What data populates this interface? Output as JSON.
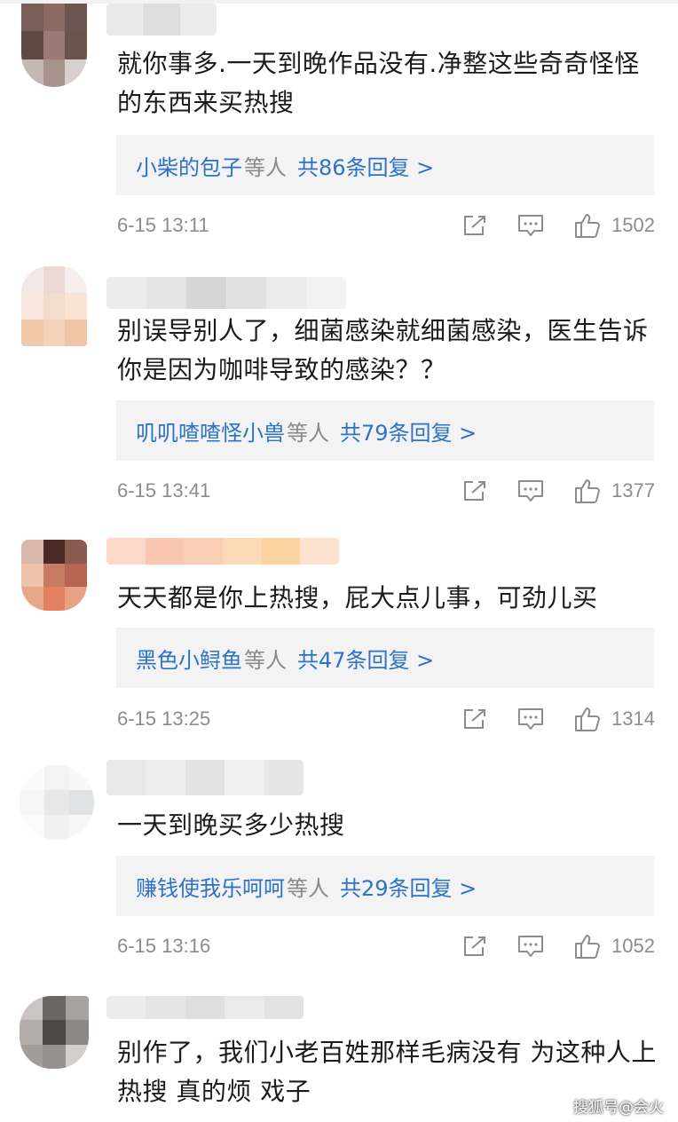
{
  "comments": [
    {
      "text": "就你事多.一天到晚作品没有.净整这些奇奇怪怪的东西来买热搜",
      "reply_names": "小柴的包子",
      "reply_others": "等人",
      "reply_count": "共86条回复 >",
      "time": "6-15 13:11",
      "likes": "1502"
    },
    {
      "text": "别误导别人了，细菌感染就细菌感染，医生告诉你是因为咖啡导致的感染？？",
      "reply_names": "叽叽喳喳怪小兽",
      "reply_others": "等人",
      "reply_count": "共79条回复 >",
      "time": "6-15 13:41",
      "likes": "1377"
    },
    {
      "text": "天天都是你上热搜，屁大点儿事，可劲儿买",
      "reply_names": "黑色小鲟鱼",
      "reply_others": "等人",
      "reply_count": "共47条回复 >",
      "time": "6-15 13:25",
      "likes": "1314"
    },
    {
      "text": "一天到晚买多少热搜",
      "reply_names": "赚钱使我乐呵呵",
      "reply_others": "等人",
      "reply_count": "共29条回复 >",
      "time": "6-15 13:16",
      "likes": "1052"
    },
    {
      "text": "别作了，我们小老百姓那样毛病没有 为这种人上热搜 真的烦 戏子"
    }
  ],
  "watermark": "搜狐号@会火",
  "icons": {
    "share": "share-icon",
    "comment": "comment-icon",
    "like": "like-icon"
  },
  "colors": {
    "link": "#2c72c7",
    "reply_bg": "#f3f3f3",
    "meta": "#8c8c8c"
  }
}
